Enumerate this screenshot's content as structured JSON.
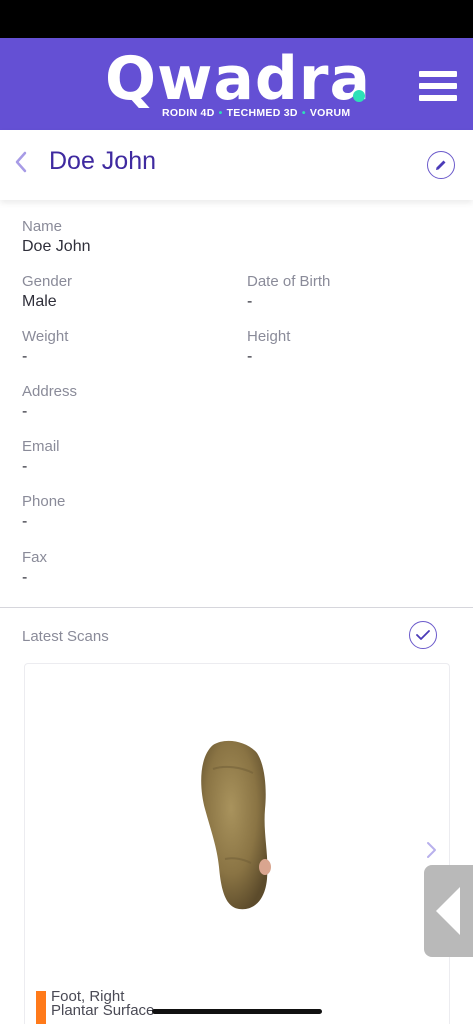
{
  "header": {
    "brand": "Qwadra",
    "brand_sub": [
      "RODIN 4D",
      "TECHMED 3D",
      "VORUM"
    ],
    "accent": "#6450d4",
    "brand_dot_color": "#2de0b8"
  },
  "patient": {
    "title": "Doe John"
  },
  "details": {
    "name_label": "Name",
    "name_value": "Doe John",
    "gender_label": "Gender",
    "gender_value": "Male",
    "dob_label": "Date of Birth",
    "dob_value": "-",
    "weight_label": "Weight",
    "weight_value": "-",
    "height_label": "Height",
    "height_value": "-",
    "address_label": "Address",
    "address_value": "-",
    "email_label": "Email",
    "email_value": "-",
    "phone_label": "Phone",
    "phone_value": "-",
    "fax_label": "Fax",
    "fax_value": "-"
  },
  "scans": {
    "heading": "Latest Scans",
    "items": [
      {
        "line1": "Foot, Right",
        "line2": "Plantar Surface",
        "tag_color": "#ff7a1a"
      }
    ]
  },
  "icons": {
    "back": "chevron-left-icon",
    "menu": "hamburger-menu-icon",
    "edit": "pencil-icon",
    "check": "check-circle-icon",
    "next": "chevron-right-icon",
    "side": "triangle-left-icon"
  }
}
